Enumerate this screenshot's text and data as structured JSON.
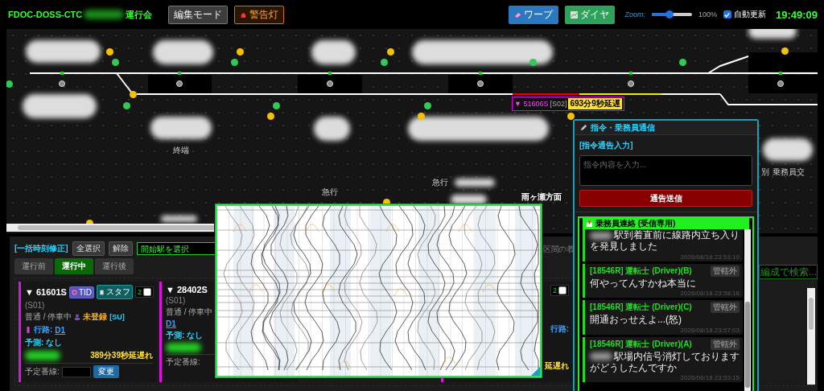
{
  "header": {
    "title": "FDOC-DOSS-CTC",
    "title_suffix": "運行会",
    "buttons": [
      {
        "label": "編集モード",
        "kind": "plain"
      },
      {
        "label": "警告灯",
        "kind": "alert"
      }
    ],
    "tools": [
      {
        "label": "ワープ",
        "kind": "warp"
      },
      {
        "label": "ダイヤ",
        "kind": "diagram"
      }
    ],
    "zoom": {
      "label": "Zoom:",
      "level": 0.45,
      "reading": "100%"
    },
    "auto_update": {
      "label": "自動更新",
      "checked": true
    },
    "clock": "19:49:09"
  },
  "map": {
    "labels": [
      "終端",
      "急行",
      "急行",
      "雨ヶ瀬方面",
      "別",
      "乗務員交"
    ],
    "signals": [
      {
        "color": "#f5c000"
      },
      {
        "color": "#2ecc55"
      },
      {
        "color": "#f5c000"
      },
      {
        "color": "#2ecc55"
      },
      {
        "color": "#f5c000"
      },
      {
        "color": "#2ecc55"
      },
      {
        "color": "#2ecc55"
      },
      {
        "color": "#2ecc55"
      },
      {
        "color": "#f5c000"
      },
      {
        "color": "#f5c000"
      },
      {
        "color": "#2ecc55"
      },
      {
        "color": "#f5c000"
      },
      {
        "color": "#2ecc55"
      },
      {
        "color": "#f5c000"
      },
      {
        "color": "#f5c000"
      },
      {
        "color": "#2ecc55"
      },
      {
        "color": "#2ecc55"
      },
      {
        "color": "#f5c000"
      },
      {
        "color": "#f5c000"
      }
    ],
    "train_tag": {
      "number": "▼ 51606S",
      "track": "[S02]",
      "delay": "693分9秒延遅"
    }
  },
  "batch": {
    "title": "[一括時刻修正]",
    "buttons": [
      "全選択",
      "解除"
    ],
    "station_select": "開始駅を選択",
    "hint": "区間の着"
  },
  "tabs": [
    {
      "label": "運行前",
      "selected": false
    },
    {
      "label": "運行中",
      "selected": true
    },
    {
      "label": "運行後",
      "selected": false
    }
  ],
  "search": {
    "placeholder": "編成で検索..."
  },
  "cards": [
    {
      "kind": "full",
      "train": "▼ 61601S",
      "buttons": [
        "TID",
        "スタフ"
      ],
      "select": "2",
      "track": "(S01)",
      "status": "普通 / 停車中",
      "crew": "未登録",
      "crew_code": "[SU]",
      "route_label": "行路:",
      "route": "D1",
      "forecast": "予測: なし",
      "delay": "389分39秒延遅れ",
      "platform_label": "予定番線:",
      "change": "変更"
    },
    {
      "kind": "left",
      "train": "▼ 28402S",
      "track": "(S01)",
      "status": "普通 / 停車中",
      "route": "D1",
      "forecast": "予測: なし",
      "platform_label": "予定番線:"
    },
    {
      "kind": "right",
      "select": "2",
      "route_label": "行路:",
      "delay": "延遅れ"
    }
  ],
  "comm": {
    "title": "指令・乗務員通信",
    "input_title": "[指令通告入力]",
    "placeholder": "指令内容を入力...",
    "send": "通告送信",
    "inbox_title": "乗務員連絡 (受信専用)",
    "messages": [
      {
        "kind": "cut",
        "text": "駅到着直前に線路内立ち入りを発見しました",
        "time": "2026/08/18 23:53:10"
      },
      {
        "kind": "full",
        "sender": "[18546R] 運転士 (Driver)(B)",
        "badge": "管轄外",
        "text": "何やってんすかね本当に",
        "time": "2026/08/18 23:58:18"
      },
      {
        "kind": "full",
        "sender": "[18546R] 運転士 (Driver)(C)",
        "badge": "管轄外",
        "text": "開通おっせえよ...(怒)",
        "time": "2026/08/18 23:57:03"
      },
      {
        "kind": "redacted",
        "sender": "[18546R] 運転士 (Driver)(A)",
        "badge": "管轄外",
        "text": "駅場内信号消灯しておりますがどうしたんですか",
        "time": "2026/08/18 23:53:15"
      }
    ]
  }
}
